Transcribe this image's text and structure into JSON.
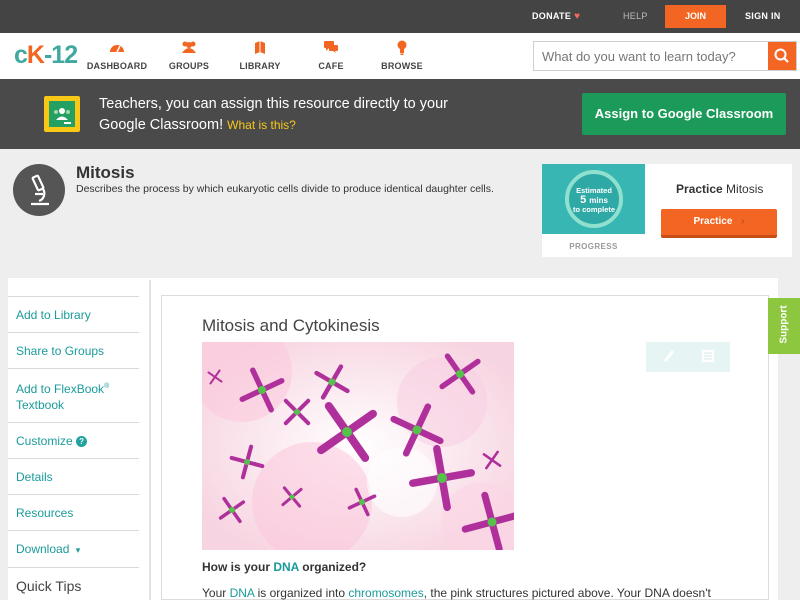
{
  "topbar": {
    "donate": "DONATE",
    "help": "HELP",
    "join": "JOIN",
    "signin": "SIGN IN"
  },
  "nav": {
    "logo_left": "c",
    "logo_k": "K",
    "logo_right": "-12",
    "items": [
      {
        "label": "DASHBOARD",
        "icon": "dashboard-icon"
      },
      {
        "label": "GROUPS",
        "icon": "groups-icon"
      },
      {
        "label": "LIBRARY",
        "icon": "library-icon"
      },
      {
        "label": "CAFE",
        "icon": "cafe-icon"
      },
      {
        "label": "BROWSE",
        "icon": "browse-icon"
      }
    ],
    "search_placeholder": "What do you want to learn today?"
  },
  "banner": {
    "text": "Teachers, you can assign this resource directly to your Google Classroom!",
    "what_is": "What is this?",
    "button": "Assign to Google Classroom"
  },
  "concept": {
    "title": "Mitosis",
    "description": "Describes the process by which eukaryotic cells divide to produce identical daughter cells."
  },
  "practice": {
    "estimated": "Estimated",
    "mins": "5",
    "mins_label": "mins",
    "to_complete": "to complete",
    "progress_label": "PROGRESS",
    "heading_bold": "Practice",
    "heading_rest": "Mitosis",
    "button": "Practice"
  },
  "sidebar": {
    "add_library": "Add to Library",
    "share_groups": "Share to Groups",
    "add_flexbook": "Add to FlexBook",
    "reg": "®",
    "textbook": "Textbook",
    "customize": "Customize",
    "customize_badge": "?",
    "details": "Details",
    "resources": "Resources",
    "download": "Download",
    "download_caret": "▾",
    "quick_tips": "Quick Tips"
  },
  "article": {
    "title": "Mitosis and Cytokinesis",
    "question_pre": "How is your ",
    "question_link": "DNA",
    "question_post": " organized?",
    "body_pre": "Your ",
    "body_link1": "DNA",
    "body_mid": " is organized into ",
    "body_link2": "chromosomes",
    "body_post": ", the pink structures pictured above. Your DNA doesn't"
  },
  "support": "Support",
  "colors": {
    "brand_orange": "#f26522",
    "brand_teal": "#1b9a9a",
    "google_green": "#1b9a59",
    "support_green": "#8dc63f",
    "chromosome_purple": "#b0309b",
    "chromosome_green": "#55c24a"
  }
}
